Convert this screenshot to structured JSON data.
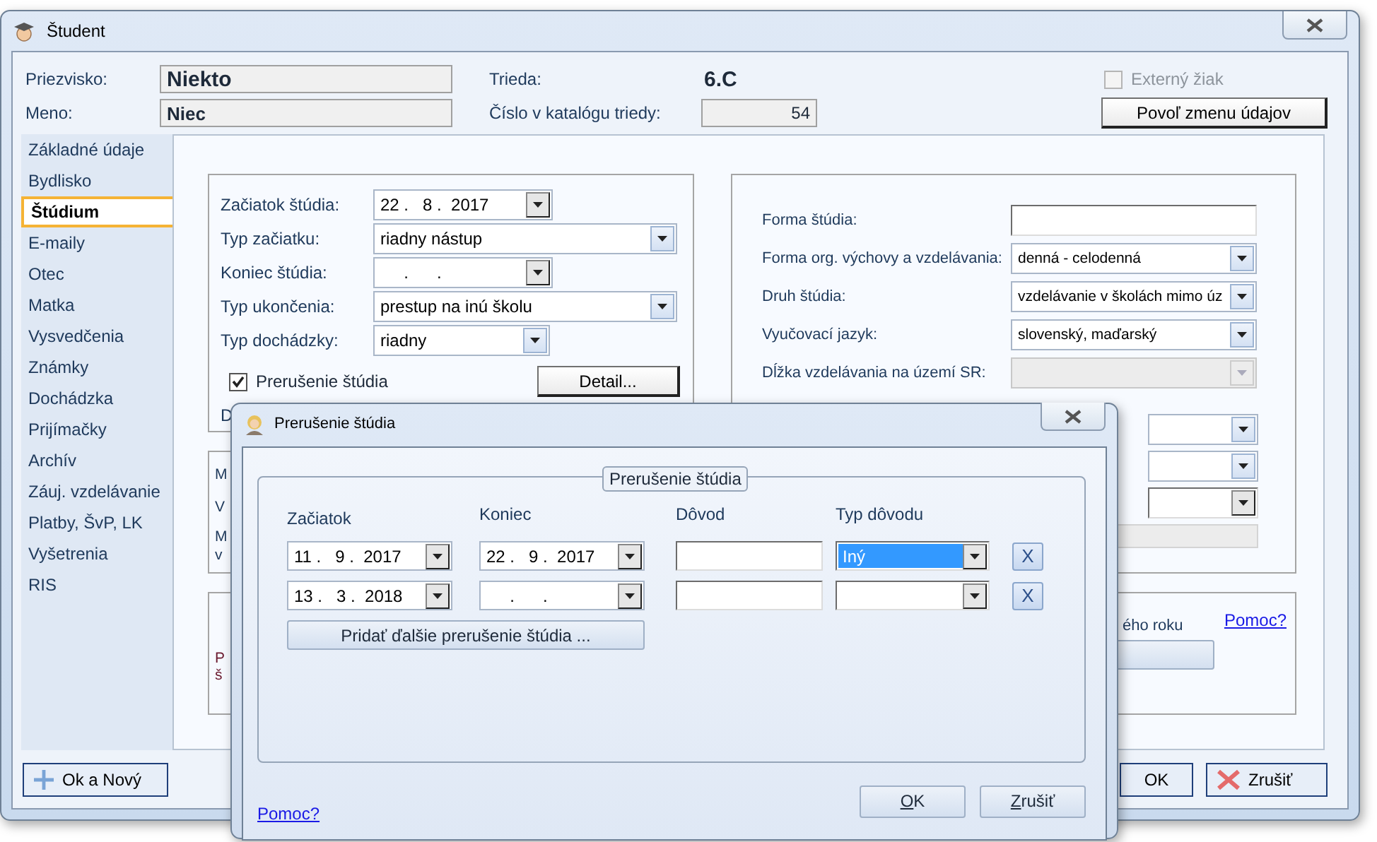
{
  "window": {
    "title": "Študent"
  },
  "header": {
    "fields": [
      {
        "label": "Priezvisko:",
        "value": "Niekto"
      },
      {
        "label": "Meno:",
        "value": "Niec"
      }
    ],
    "class": {
      "label": "Trieda:",
      "value": "6.C"
    },
    "catalog": {
      "label": "Číslo v katalógu triedy:",
      "value": "54"
    },
    "external": {
      "label": "Externý žiak",
      "checked": false,
      "disabled": true
    },
    "allow_button": "Povoľ zmenu údajov"
  },
  "sidebar": {
    "items": [
      {
        "label": "Základné údaje",
        "selected": false
      },
      {
        "label": "Bydlisko",
        "selected": false
      },
      {
        "label": "Štúdium",
        "selected": true
      },
      {
        "label": "E-maily",
        "selected": false
      },
      {
        "label": "Otec",
        "selected": false
      },
      {
        "label": "Matka",
        "selected": false
      },
      {
        "label": "Vysvedčenia",
        "selected": false
      },
      {
        "label": "Známky",
        "selected": false
      },
      {
        "label": "Dochádzka",
        "selected": false
      },
      {
        "label": "Prijímačky",
        "selected": false
      },
      {
        "label": "Archív",
        "selected": false
      },
      {
        "label": "Záuj. vzdelávanie",
        "selected": false
      },
      {
        "label": "Platby, ŠvP, LK",
        "selected": false
      },
      {
        "label": "Vyšetrenia",
        "selected": false
      },
      {
        "label": "RIS",
        "selected": false
      }
    ]
  },
  "study": {
    "rows": [
      {
        "label": "Začiatok štúdia:",
        "kind": "date",
        "value": "22 .   8 .  2017"
      },
      {
        "label": "Typ začiatku:",
        "kind": "combo",
        "value": "riadny nástup"
      },
      {
        "label": "Koniec štúdia:",
        "kind": "date",
        "value": "     .      ."
      },
      {
        "label": "Typ ukončenia:",
        "kind": "combo",
        "value": "prestup na inú školu"
      },
      {
        "label": "Typ dochádzky:",
        "kind": "combo_short",
        "value": "riadny"
      }
    ],
    "interruption": {
      "label": "Prerušenie štúdia",
      "checked": true
    },
    "detail_button": "Detail...",
    "cut_label": "D"
  },
  "form": {
    "rows": [
      {
        "label": "Forma štúdia:",
        "kind": "text",
        "disabled": false
      },
      {
        "label": "Forma org. výchovy a vzdelávania:",
        "kind": "combo",
        "value": "denná - celodenná",
        "disabled": false
      },
      {
        "label": "Druh štúdia:",
        "kind": "combo",
        "value": "vzdelávanie v školách mimo úz",
        "disabled": false
      },
      {
        "label": "Vyučovací jazyk:",
        "kind": "combo",
        "value": "slovenský, maďarský",
        "disabled": false
      },
      {
        "label": "Dĺžka vzdelávania na území SR:",
        "kind": "combo",
        "disabled": true
      }
    ],
    "extra_fields": [
      {
        "kind": "combo"
      },
      {
        "kind": "combo"
      },
      {
        "kind": "date"
      }
    ]
  },
  "box_b": {
    "cut_texts": [
      "M",
      "V",
      "M",
      "v"
    ]
  },
  "box_d": {
    "cut_texts": [
      "P",
      "š"
    ],
    "cut_caption": "ého roku",
    "help_link": "Pomoc?"
  },
  "buttons": {
    "ok_new": "Ok a Nový",
    "ok": "OK",
    "cancel": "Zrušiť"
  },
  "dialog": {
    "title": "Prerušenie štúdia",
    "group": "Prerušenie štúdia",
    "columns": [
      "Začiatok",
      "Koniec",
      "Dôvod",
      "Typ dôvodu"
    ],
    "rows": [
      {
        "start": "11 .   9 .  2017",
        "end": "22 .   9 .  2017",
        "reason_type": "Iný",
        "focused": true,
        "remove": "X"
      },
      {
        "start": "13 .   3 .  2018",
        "end": "     .      .",
        "focused": false,
        "remove": "X"
      }
    ],
    "add_button": "Pridať ďalšie prerušenie štúdia ...",
    "help_link": "Pomoc?",
    "ok": "OK",
    "cancel": "Zrušiť"
  }
}
